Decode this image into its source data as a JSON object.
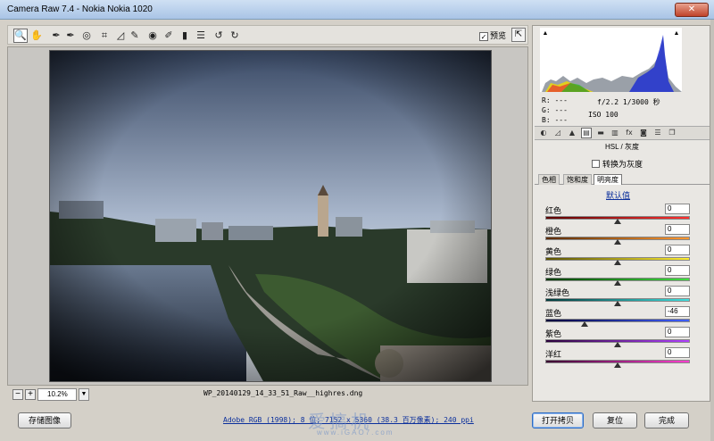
{
  "window": {
    "title": "Camera Raw 7.4 -  Nokia Nokia 1020",
    "close_label": "✕"
  },
  "toolbar": {
    "tools": [
      {
        "name": "zoom-tool-icon",
        "glyph": "🔍"
      },
      {
        "name": "hand-tool-icon",
        "glyph": "✋"
      },
      {
        "name": "white-balance-tool-icon",
        "glyph": "✒"
      },
      {
        "name": "color-sampler-tool-icon",
        "glyph": "✒"
      },
      {
        "name": "targeted-adjust-tool-icon",
        "glyph": "◎"
      },
      {
        "name": "crop-tool-icon",
        "glyph": "⌗"
      },
      {
        "name": "straighten-tool-icon",
        "glyph": "◿"
      },
      {
        "name": "spot-removal-tool-icon",
        "glyph": "✎"
      },
      {
        "name": "red-eye-tool-icon",
        "glyph": "◉"
      },
      {
        "name": "adjustment-brush-icon",
        "glyph": "✐"
      },
      {
        "name": "graduated-filter-icon",
        "glyph": "▮"
      },
      {
        "name": "preferences-icon",
        "glyph": "☰"
      },
      {
        "name": "rotate-left-icon",
        "glyph": "↺"
      },
      {
        "name": "rotate-right-icon",
        "glyph": "↻"
      }
    ],
    "preview_label": "预览",
    "preview_checked": "✓",
    "fullscreen_glyph": "⇱"
  },
  "status": {
    "zoom_out": "−",
    "zoom_in": "+",
    "zoom": "10.2%",
    "zoom_dropdown": "▼",
    "filename": "WP_20140129_14_33_51_Raw__highres.dng"
  },
  "footer": {
    "save_image": "存储图像",
    "workflow": "Adobe RGB (1998); 8 位; 7152 x 5360 (38.3 百万像素); 240 ppi",
    "open_copy": "打开拷贝",
    "reset": "复位",
    "done": "完成",
    "watermark": "爱搞机",
    "watermark_url": "www.iGAO7.com"
  },
  "info": {
    "r": "R:  ---",
    "g": "G:  ---",
    "b": "B:  ---",
    "aperture_shutter": "f/2.2  1/3000 秒",
    "iso": "ISO 100"
  },
  "panel_tabs": [
    {
      "name": "tab-basic-icon",
      "glyph": "◐"
    },
    {
      "name": "tab-tone-curve-icon",
      "glyph": "◿"
    },
    {
      "name": "tab-detail-icon",
      "glyph": "▲"
    },
    {
      "name": "tab-hsl-icon",
      "glyph": "▤"
    },
    {
      "name": "tab-split-toning-icon",
      "glyph": "▬"
    },
    {
      "name": "tab-lens-corrections-icon",
      "glyph": "▥"
    },
    {
      "name": "tab-effects-icon",
      "glyph": "fx"
    },
    {
      "name": "tab-camera-calibration-icon",
      "glyph": "◙"
    },
    {
      "name": "tab-presets-icon",
      "glyph": "☰"
    },
    {
      "name": "tab-snapshots-icon",
      "glyph": "❐"
    }
  ],
  "hsl": {
    "section_title": "HSL / 灰度",
    "grayscale_label": "转换为灰度",
    "subtabs": [
      "色相",
      "饱和度",
      "明亮度"
    ],
    "active_subtab": "明亮度",
    "default_link": "默认值",
    "sliders": [
      {
        "label": "红色",
        "value": "0",
        "num": 0,
        "gradient": [
          "#5a0000",
          "#ff3030"
        ]
      },
      {
        "label": "橙色",
        "value": "0",
        "num": 0,
        "gradient": [
          "#5a2a00",
          "#ff9830"
        ]
      },
      {
        "label": "黄色",
        "value": "0",
        "num": 0,
        "gradient": [
          "#5a5200",
          "#ffee30"
        ]
      },
      {
        "label": "绿色",
        "value": "0",
        "num": 0,
        "gradient": [
          "#003a00",
          "#40e040"
        ]
      },
      {
        "label": "浅绿色",
        "value": "0",
        "num": 0,
        "gradient": [
          "#003a3a",
          "#40e0e0"
        ]
      },
      {
        "label": "蓝色",
        "value": "-46",
        "num": -46,
        "gradient": [
          "#00003a",
          "#4060ff"
        ]
      },
      {
        "label": "紫色",
        "value": "0",
        "num": 0,
        "gradient": [
          "#2a003a",
          "#b040ff"
        ]
      },
      {
        "label": "洋红",
        "value": "0",
        "num": 0,
        "gradient": [
          "#3a0030",
          "#ff40d0"
        ]
      }
    ]
  },
  "colors": {
    "accent": "#2b6bc4"
  }
}
